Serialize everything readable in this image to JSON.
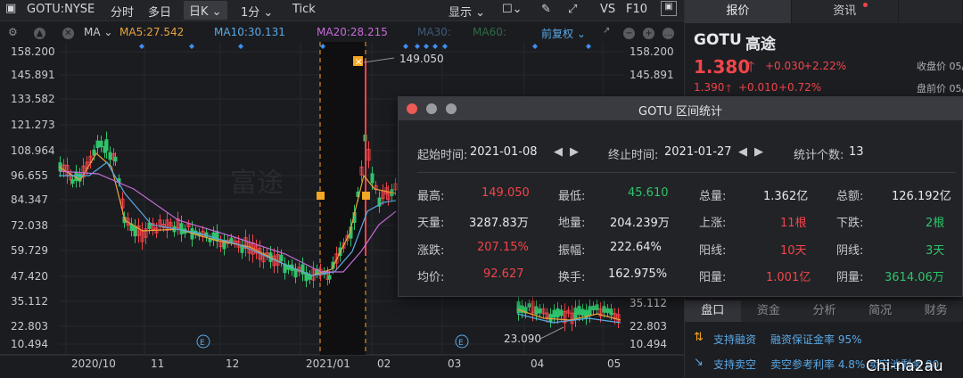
{
  "toolbar": {
    "symbol": "GOTU:NYSE",
    "tabs": [
      "分时",
      "多日",
      "日K",
      "1分",
      "Tick"
    ],
    "period_selected": "日K",
    "display_label": "显示",
    "vs": "VS",
    "f10": "F10"
  },
  "indicators": {
    "ma_label": "MA",
    "ma5": "MA5:27.542",
    "ma10": "MA10:30.131",
    "ma20": "MA20:28.215",
    "ma30": "MA30:",
    "ma60": "MA60:",
    "adjust": "前复权"
  },
  "y_axis": [
    "158.200",
    "145.891",
    "133.582",
    "121.273",
    "108.964",
    "96.655",
    "84.347",
    "72.038",
    "59.729",
    "47.420",
    "35.112",
    "22.803",
    "10.494"
  ],
  "x_axis": [
    "2020/10",
    "11",
    "12",
    "2021/01",
    "02",
    "03",
    "04",
    "05"
  ],
  "annotations": {
    "high": "149.050",
    "low": "23.090",
    "event": "E",
    "watermark": "富途"
  },
  "colors": {
    "up": "#f0454a",
    "down": "#2fc46b",
    "ma5": "#e8a33c",
    "ma10": "#5aa9e6",
    "ma20": "#c56cd6",
    "marker": "#f5a623"
  },
  "quote": {
    "tabs": [
      "报价",
      "资讯"
    ],
    "code": "GOTU",
    "name": "高途",
    "price": "1.380",
    "change": "+0.030",
    "pct": "+2.22%",
    "close_label": "收盘价 05/",
    "pre_price": "1.390",
    "pre_change": "+0.010",
    "pre_pct": "+0.72%",
    "pre_label": "盘前价 05/"
  },
  "bottom_tabs": [
    "盘口",
    "资金",
    "分析",
    "简况",
    "财务"
  ],
  "margin": [
    {
      "tag": "支持融资",
      "text": "融资保证金率 95%"
    },
    {
      "tag": "支持卖空",
      "text": "卖空参考利率 4.8%  卖空池剩余 80"
    }
  ],
  "watermark_text": "Chi-na2au",
  "dialog": {
    "title": "GOTU 区间统计",
    "start_label": "起始时间:",
    "start": "2021-01-08",
    "end_label": "终止时间:",
    "end": "2021-01-27",
    "count_label": "统计个数:",
    "count": "13",
    "stats": [
      [
        "最高:",
        "149.050",
        "最低:",
        "45.610",
        "总量:",
        "1.362亿",
        "总额:",
        "126.192亿"
      ],
      [
        "天量:",
        "3287.83万",
        "地量:",
        "204.239万",
        "上涨:",
        "11根",
        "下跌:",
        "2根"
      ],
      [
        "涨跌:",
        "207.15%",
        "振幅:",
        "222.64%",
        "阳线:",
        "10天",
        "阴线:",
        "3天"
      ],
      [
        "均价:",
        "92.627",
        "换手:",
        "162.975%",
        "阳量:",
        "1.001亿",
        "阴量:",
        "3614.06万"
      ]
    ]
  }
}
